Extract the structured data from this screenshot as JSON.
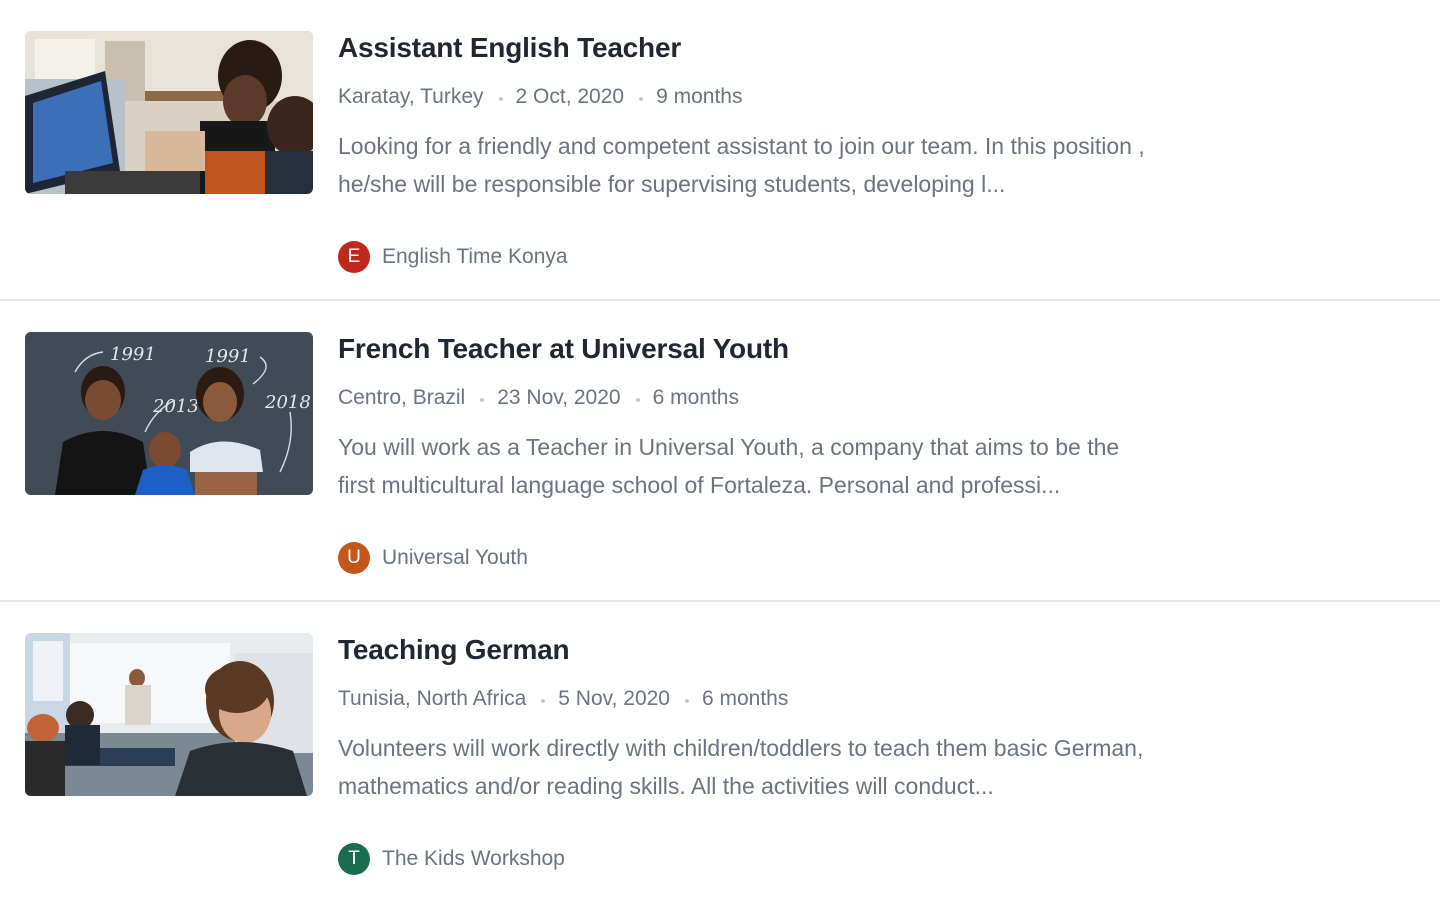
{
  "jobs": [
    {
      "title": "Assistant English Teacher",
      "location": "Karatay, Turkey",
      "date": "2 Oct, 2020",
      "duration": "9 months",
      "description": "Looking for a friendly and competent assistant to join our team. In this position , he/she will be responsible for supervising students, developing l...",
      "org_initial": "E",
      "org_name": "English Time Konya",
      "org_color": "#c0271d"
    },
    {
      "title": "French Teacher at Universal Youth",
      "location": "Centro, Brazil",
      "date": "23 Nov, 2020",
      "duration": "6 months",
      "description": "You will work as a Teacher in Universal Youth, a company that aims to be the first multicultural language school of Fortaleza. Personal and professi...",
      "org_initial": "U",
      "org_name": "Universal Youth",
      "org_color": "#c5561b",
      "image_text": [
        "1991",
        "1991",
        "2013",
        "2018"
      ]
    },
    {
      "title": "Teaching German",
      "location": "Tunisia, North Africa",
      "date": "5 Nov, 2020",
      "duration": "6 months",
      "description": "Volunteers will work directly with children/toddlers to teach them basic German, mathematics and/or reading skills. All the activities will conduct...",
      "org_initial": "T",
      "org_name": "The Kids Workshop",
      "org_color": "#1b6b4e"
    }
  ]
}
